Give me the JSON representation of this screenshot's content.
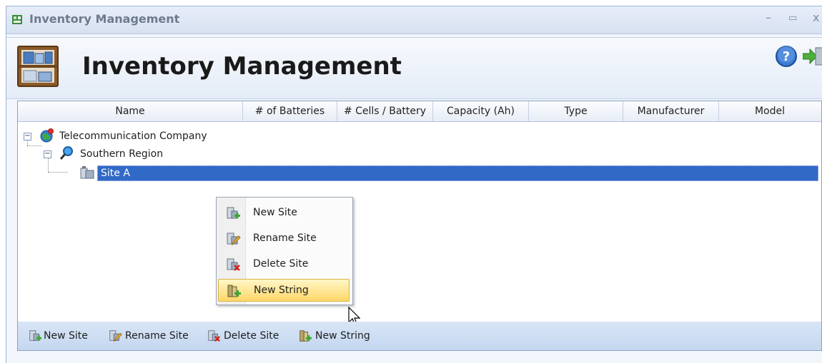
{
  "window": {
    "title": "Inventory Management",
    "controls": {
      "minimize": "–",
      "maximize": "▭",
      "close": "x"
    }
  },
  "header": {
    "heading": "Inventory Management"
  },
  "grid": {
    "columns": [
      "Name",
      "# of Batteries",
      "# Cells / Battery",
      "Capacity (Ah)",
      "Type",
      "Manufacturer",
      "Model"
    ],
    "tree": {
      "company": "Telecommunication Company",
      "region": "Southern Region",
      "site": "Site A"
    }
  },
  "context_menu": {
    "items": [
      "New Site",
      "Rename Site",
      "Delete Site",
      "New String"
    ],
    "highlighted": "New String"
  },
  "toolbar": {
    "new_site": "New Site",
    "rename_site": "Rename Site",
    "delete_site": "Delete Site",
    "new_string": "New String"
  },
  "colors": {
    "selection": "#3169c6",
    "menu_highlight": "#ffd767",
    "toolbar": "#c4d7f0"
  },
  "icons": {
    "app": "inventory-shelf-icon",
    "help": "help-icon",
    "exit": "exit-icon",
    "company": "globe-icon",
    "region": "magnifier-icon",
    "site": "battery-site-icon"
  }
}
